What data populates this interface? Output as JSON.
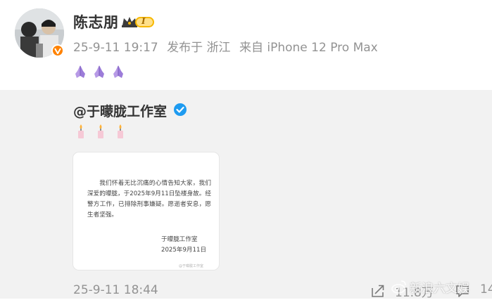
{
  "post": {
    "author_name": "陈志朋",
    "level_badge": "I",
    "timestamp": "25-9-11 19:17",
    "location": "发布于 浙江",
    "device": "来自 iPhone 12 Pro Max",
    "emoji_icons": [
      "folded-hands",
      "folded-hands",
      "folded-hands"
    ]
  },
  "repost": {
    "author": "@于曚胧工作室",
    "emoji_icons": [
      "candle",
      "candle",
      "candle"
    ],
    "notice": {
      "body": "我们怀着无比沉痛的心情告知大家，我们深爱的曚胧，于2025年9月11日坠楼身故。经警方工作，已排除刑事嫌疑。愿逝者安息，愿生者坚强。",
      "signature": "于曚胧工作室",
      "date": "2025年9月11日",
      "watermark": "@于曚胧工作室"
    },
    "time": "25-9-11 18:44",
    "share_count": "11.8万",
    "comment_count": "14"
  },
  "watermark": "新浪六文娱",
  "colors": {
    "accent_orange": "#ff8200",
    "verify_blue": "#1e9bf0",
    "meta_gray": "#939393",
    "repost_bg": "#f2f2f2"
  }
}
